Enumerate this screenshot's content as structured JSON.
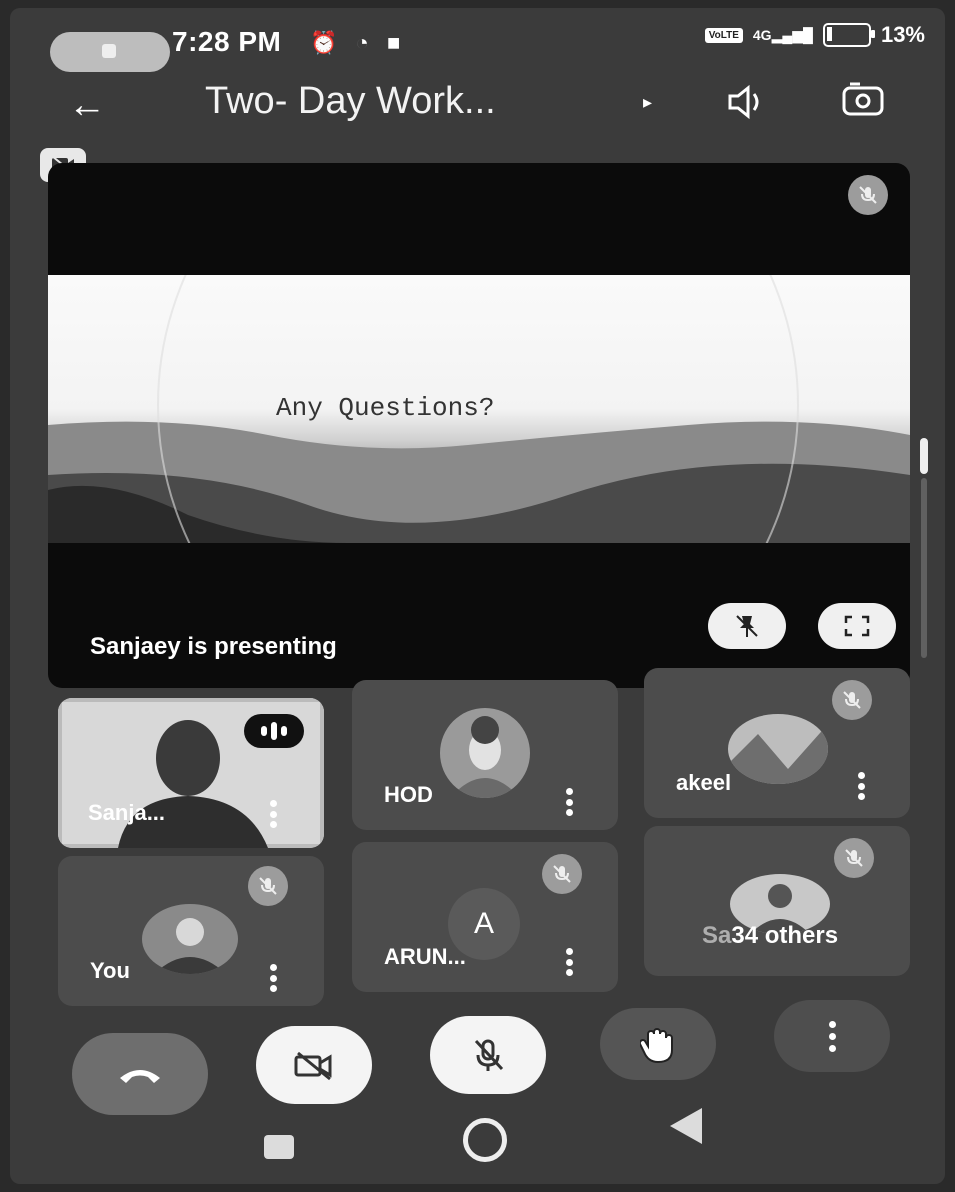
{
  "status_bar": {
    "time": "7:28 PM",
    "icons": [
      "alarm-icon",
      "whatsapp-icon",
      "notification-icon"
    ],
    "net_badge": "VoLTE",
    "net_label": "4G",
    "battery": "13%"
  },
  "header": {
    "title": "Two- Day Work...",
    "caret": "▸"
  },
  "presentation": {
    "slide_text": "Any Questions?",
    "label": "Sanjaey is presenting"
  },
  "participants": [
    {
      "name": "Sanja...",
      "speaking": true
    },
    {
      "name": "HOD"
    },
    {
      "name": "akeel",
      "muted": true
    },
    {
      "name": "You",
      "muted": true
    },
    {
      "name": "ARUN...",
      "initial": "A",
      "muted": true
    },
    {
      "name": "34 others",
      "partial_prefix": "Sa",
      "muted": true
    }
  ],
  "colors": {
    "background": "#3b3b3b",
    "tile": "#4c4c4c",
    "button_light": "#f4f4f4"
  }
}
